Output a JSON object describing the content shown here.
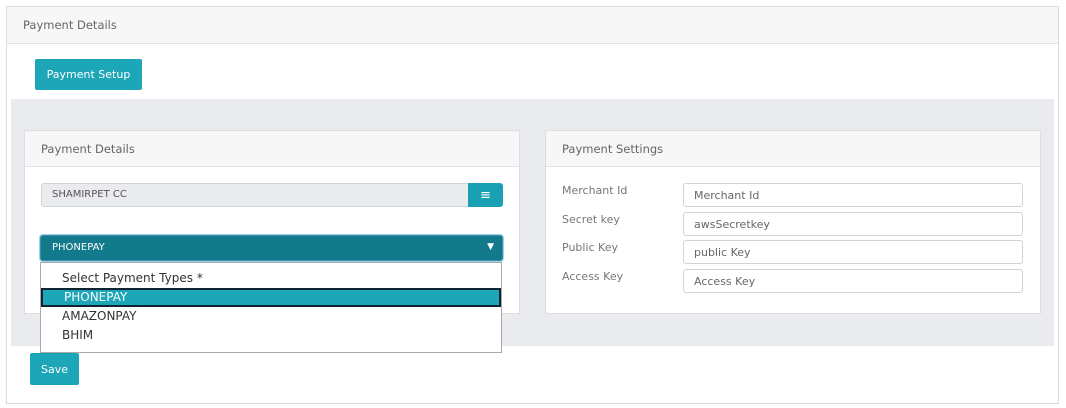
{
  "outer": {
    "title": "Payment Details"
  },
  "setup_button": "Payment Setup",
  "left_panel": {
    "title": "Payment Details",
    "branch": "SHAMIRPET CC",
    "menu_icon": "hamburger-icon",
    "payment_type_selected": "PHONEPAY",
    "dropdown_options": [
      "Select Payment Types *",
      "PHONEPAY",
      "AMAZONPAY",
      "BHIM"
    ]
  },
  "right_panel": {
    "title": "Payment Settings",
    "rows": [
      {
        "label": "Merchant Id",
        "value": "Merchant Id"
      },
      {
        "label": "Secret key",
        "value": "awsSecretkey"
      },
      {
        "label": "Public Key",
        "value": "public Key"
      },
      {
        "label": "Access Key",
        "value": "Access Key"
      }
    ]
  },
  "save_button": "Save",
  "colors": {
    "accent": "#1da5b8",
    "select_bg": "#127a8a",
    "panel_bg": "#e9ebee"
  }
}
